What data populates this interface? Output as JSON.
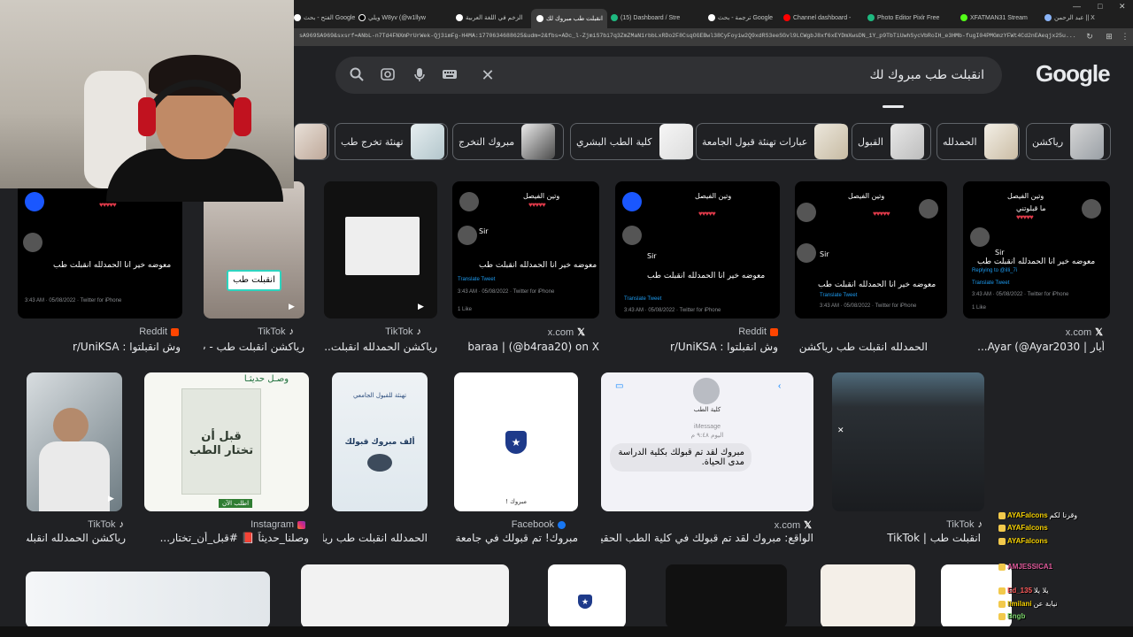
{
  "browser": {
    "tabs": [
      {
        "label": "عبد الرحمن || X",
        "active": false
      },
      {
        "label": "XFATMAN31 Stream",
        "active": false
      },
      {
        "label": "Photo Editor Pixlr Free",
        "active": false
      },
      {
        "label": "Channel dashboard - ",
        "active": false
      },
      {
        "label": "ترجمة - بحث Google",
        "active": false
      },
      {
        "label": "(15) Dashboard / Stre",
        "active": false
      },
      {
        "label": "انقبلت طب مبروك لك",
        "active": true
      },
      {
        "label": "الزخم في اللغة العربية",
        "active": false
      },
      {
        "label": "ويلي W8yv (@w1llyw",
        "active": false
      },
      {
        "label": "الفتح - بحث Google",
        "active": false
      }
    ],
    "url": "sA969SA969&sxsrf=ANbL-n7Td4FNXmPrUrWek-Qj3imFg-H4MA:1770634688625&udm=2&fbs=ADc_l-ZjmiS7bi7q3ZmZMaN1rbbLxRDo2F8CsqOGEBwl38CyFoyiw2Q9xdRS3eeSGvl9LCWgbJ8xf6xEYDmXwsDN_1Y_p9TbTiUwhSycVbRoIH_e3HMb-fugI04PMGmzYFWt4Cd2nEAeqjx25u..."
  },
  "search": {
    "logo": "Google",
    "query": "انقبلت طب مبروك لك",
    "clear_icon": "close-icon"
  },
  "chips": [
    {
      "label": "رياكشن"
    },
    {
      "label": "الحمدلله"
    },
    {
      "label": "القبول"
    },
    {
      "label": "عبارات تهنئة قبول الجامعة"
    },
    {
      "label": "كلية الطب البشري"
    },
    {
      "label": "مبروك التخرج"
    },
    {
      "label": "تهنئة تخرج طب"
    }
  ],
  "row1": [
    {
      "source": "x.com",
      "title": "أيار | Ayar (@Ayar2030..."
    },
    {
      "source": "",
      "title": "الحمدلله انقبلت طب رياكشن | ok..."
    },
    {
      "source": "Reddit",
      "title": "وش انقبلتوا : r/UniKSA"
    },
    {
      "source": "x.com",
      "title": "baraa | (@b4raa20) on X"
    },
    {
      "source": "TikTok",
      "title": "رياكشن الحمدلله انقبلت..."
    },
    {
      "source": "TikTok",
      "title": "رياكشن انقبلت طب - ت..."
    },
    {
      "source": "Reddit",
      "title": "وش انقبلتوا : r/UniKSA"
    }
  ],
  "row2": [
    {
      "source": "TikTok",
      "title": "انقبلت طب | TikTok"
    },
    {
      "source": "x.com",
      "title": "الواقع: مبروك لقد تم قبولك في كلية الطب الحقيقة:"
    },
    {
      "source": "Facebook",
      "title": "مبروك! تم قبولك في جامعة ..."
    },
    {
      "source": "",
      "title": "الحمدلله انقبلت طب ريا..."
    },
    {
      "source": "Instagram",
      "title": "وصلنا_حديثاً 📕 #قبل_أن_تختار..."
    },
    {
      "source": "TikTok",
      "title": "رياكشن الحمدلله انقبلت..."
    }
  ],
  "tweet": {
    "name": "وتين الفيصل",
    "handle": "@illi_7i · 10h",
    "text": "ما قبلوتني",
    "reply_name": "Sir",
    "reply_handle": "@liwlz",
    "replying": "Replying to @illi_7i",
    "reply_text": "معوضه خير انا الحمدلله انقبلت طب",
    "translate": "Translate Tweet",
    "timestamp": "3:43 AM · 05/08/2022 · Twitter for iPhone",
    "likes": "1 Like"
  },
  "imessage": {
    "label": "iMessage",
    "day": "اليوم ٩:٤٨ م",
    "contact": "كلية الطب",
    "message": "مبروك لقد تم قبولك بكلية الدراسة مدى الحياة."
  },
  "books": {
    "book1_title": "قبل أن تختار الطب",
    "book1_btn": "اطلب الآن",
    "book1_header": "وصـل حديثـا",
    "congrats": "ألف مبروك قبولك",
    "congrats_top": "تهنئة للقبول الجامعي",
    "mabrouk": "مبروك !"
  },
  "tiktok_badge": "انقبلت طب",
  "chat": [
    {
      "name": "AYAFalcons",
      "msg": "وقرنا لكم"
    },
    {
      "name": "AYAFalcons",
      "msg": ""
    },
    {
      "name": "AYAFalcons",
      "msg": ""
    },
    {
      "name": "AMJESSICA1",
      "msg": ""
    },
    {
      "name": "Ed_135",
      "msg": "يلا يلا"
    },
    {
      "name": "limilani",
      "msg": "نيابة عن"
    },
    {
      "name": "Bngb",
      "msg": ""
    }
  ],
  "colors": {
    "background": "#202124",
    "searchbox": "#303134",
    "accent_blue": "#8ab4f8",
    "reddit": "#ff4500",
    "heart": "#e03a4a"
  }
}
